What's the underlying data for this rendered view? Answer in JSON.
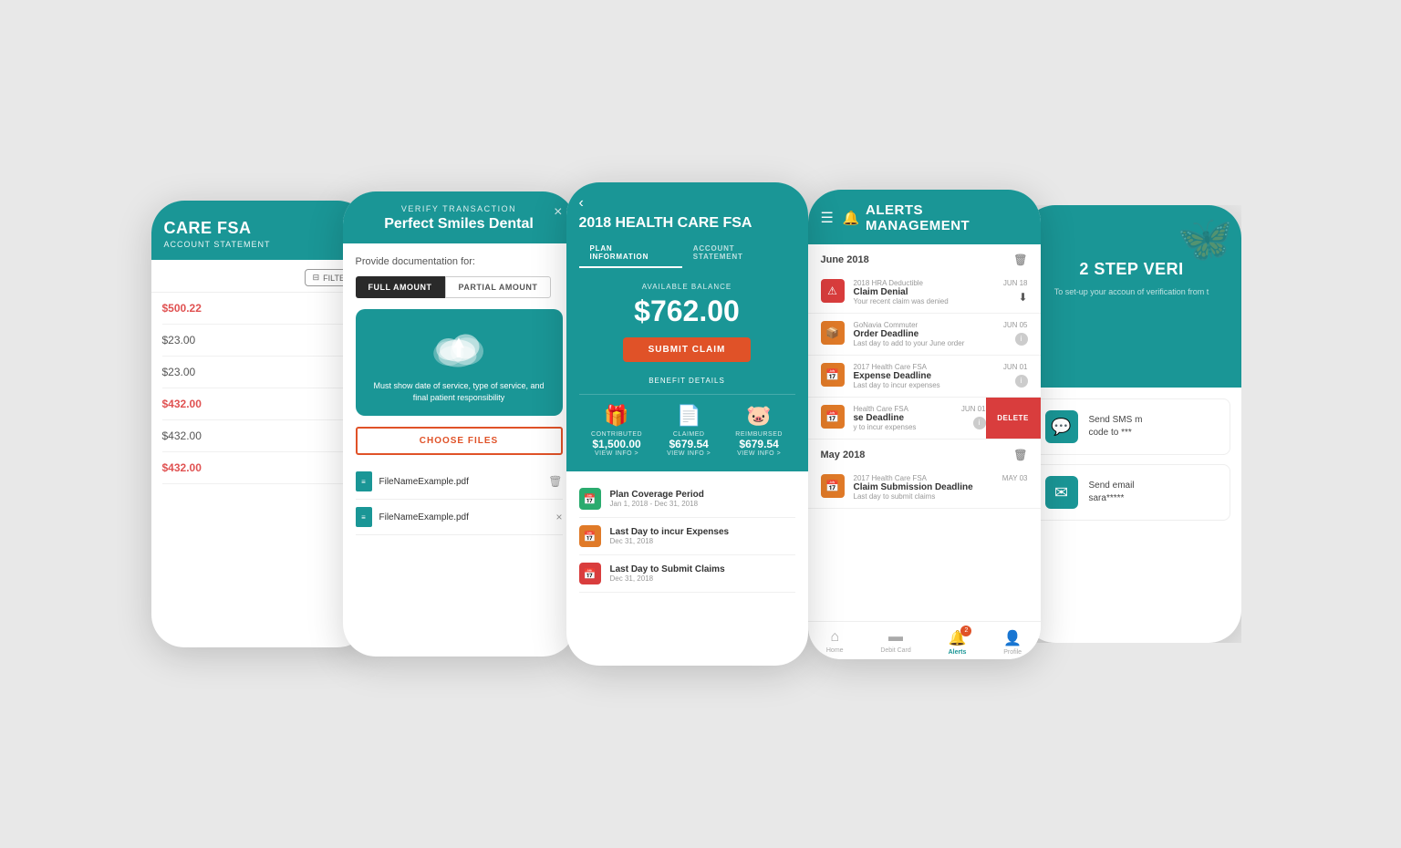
{
  "background": "#e8e8e8",
  "phones": {
    "phone1": {
      "title": "CARE FSA",
      "subtitle": "ACCOUNT STATEMENT",
      "filter_label": "FILTER",
      "items": [
        {
          "amount": "$500.22",
          "color": "red"
        },
        {
          "amount": "$23.00",
          "color": "gray"
        },
        {
          "amount": "$23.00",
          "color": "gray"
        },
        {
          "amount": "$432.00",
          "color": "red"
        },
        {
          "amount": "$432.00",
          "color": "gray"
        },
        {
          "amount": "$432.00",
          "color": "red"
        }
      ]
    },
    "phone2": {
      "header_label": "VERIFY TRANSACTION",
      "header_title": "Perfect Smiles Dental",
      "provide_text": "Provide documentation for:",
      "tab_full": "FULL AMOUNT",
      "tab_partial": "PARTIAL AMOUNT",
      "upload_text": "Must show date of service, type of service, and final patient responsibility",
      "choose_files": "CHOOSE FILES",
      "files": [
        {
          "name": "FileNameExample.pdf",
          "deletable": true
        },
        {
          "name": "FileNameExample.pdf",
          "deletable": false
        }
      ]
    },
    "phone3": {
      "back_icon": "‹",
      "title": "2018 HEALTH CARE FSA",
      "tab_plan": "PLAN INFORMATION",
      "tab_account": "ACCOUNT STATEMENT",
      "balance_label": "AVAILABLE BALANCE",
      "balance": "$762.00",
      "submit_btn": "SUBMIT CLAIM",
      "benefit_title": "BENEFIT DETAILS",
      "contributed_label": "CONTRIBUTED",
      "contributed_amount": "$1,500.00",
      "claimed_label": "CLAIMED",
      "claimed_amount": "$679.54",
      "reimbursed_label": "REIMBURSED",
      "reimbursed_amount": "$679.54",
      "view_info": "VIEW INFO >",
      "details": [
        {
          "color": "green",
          "title": "Plan Coverage Period",
          "value": "Jan 1, 2018 - Dec 31, 2018"
        },
        {
          "color": "orange",
          "title": "Last Day to incur Expenses",
          "value": "Dec 31, 2018"
        },
        {
          "color": "red",
          "title": "Last Day to Submit Claims",
          "value": "Dec 31, 2018"
        }
      ]
    },
    "phone4": {
      "menu_icon": "☰",
      "bell_icon": "🔔",
      "title": "ALERTS MANAGEMENT",
      "months": [
        {
          "name": "June 2018",
          "alerts": [
            {
              "org": "2018 HRA Deductible",
              "title": "Claim Denial",
              "sub": "Your recent claim was denied",
              "date": "JUN 18",
              "icon_color": "red",
              "has_download": true,
              "show_delete": false
            },
            {
              "org": "GoNavia Commuter",
              "title": "Order Deadline",
              "sub": "Last day to add to your June order",
              "date": "JUN 05",
              "icon_color": "orange",
              "has_download": false,
              "show_delete": false
            },
            {
              "org": "2017 Health Care FSA",
              "title": "Expense Deadline",
              "sub": "Last day to incur expenses",
              "date": "JUN 01",
              "icon_color": "orange",
              "has_download": false,
              "show_delete": false
            },
            {
              "org": "Health Care FSA",
              "title": "se Deadline",
              "sub": "y to incur expenses",
              "date": "JUN 01",
              "icon_color": "orange",
              "has_download": false,
              "show_delete": true
            }
          ]
        },
        {
          "name": "May 2018",
          "alerts": [
            {
              "org": "2017 Health Care FSA",
              "title": "Claim Submission Deadline",
              "sub": "Last day to submit claims",
              "date": "MAY 03",
              "icon_color": "red",
              "has_download": false,
              "show_delete": false
            }
          ]
        }
      ],
      "nav": [
        {
          "label": "Home",
          "icon": "⌂",
          "active": false
        },
        {
          "label": "Debit Card",
          "icon": "💳",
          "active": false
        },
        {
          "label": "Alerts",
          "icon": "🔔",
          "active": true,
          "badge": "2"
        },
        {
          "label": "Profile",
          "icon": "👤",
          "active": false
        }
      ]
    },
    "phone5": {
      "title": "2 STEP VERI",
      "sub": "To set-up your accoun of verification from t",
      "options": [
        {
          "label": "Send SMS m code to ***",
          "icon": "💬"
        },
        {
          "label": "Send email sara*****",
          "icon": "✉"
        }
      ]
    }
  }
}
